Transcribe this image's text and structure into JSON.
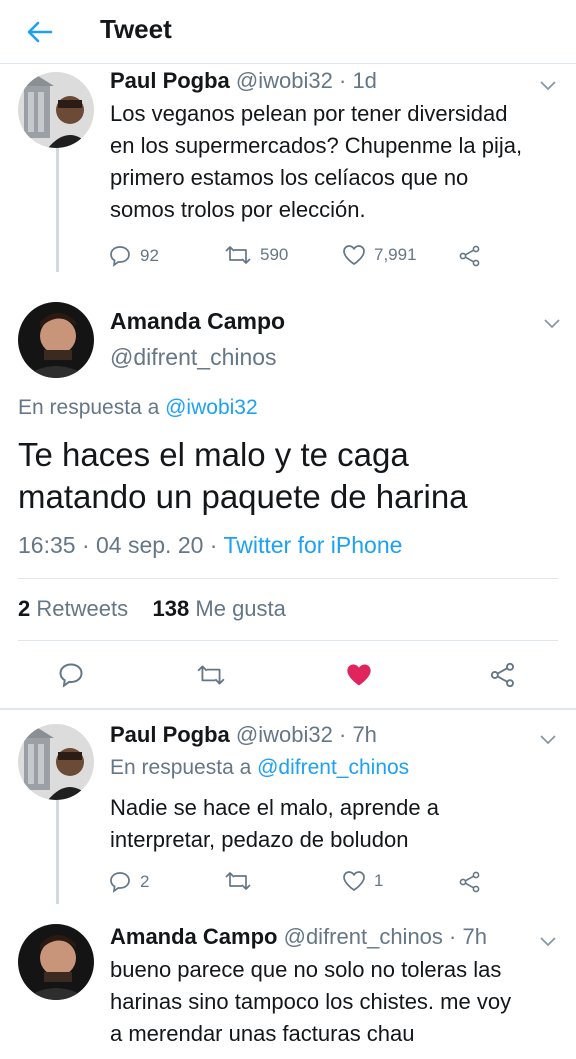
{
  "header": {
    "title": "Tweet"
  },
  "tweets": [
    {
      "name": "Paul Pogba",
      "handle": "@iwobi32",
      "separator": "·",
      "time": "1d",
      "lines": [
        "Los veganos pelean por tener diversidad",
        "en los supermercados? Chupenme la pija,",
        "primero estamos los celíacos que no",
        "somos trolos por elección."
      ],
      "replies": "92",
      "retweets": "590",
      "likes": "7,991"
    },
    {
      "name": "Paul Pogba",
      "handle": "@iwobi32",
      "separator": "·",
      "time": "7h",
      "replying_prefix": "En respuesta a",
      "replying_to": "@difrent_chinos",
      "lines": [
        "Nadie se hace el malo, aprende a",
        "interpretar, pedazo de boludon"
      ],
      "replies": "2",
      "retweets": "",
      "likes": "1"
    },
    {
      "name": "Amanda Campo",
      "handle": "@difrent_chinos",
      "separator": "·",
      "time": "7h",
      "lines": [
        "bueno parece que no solo no toleras las",
        "harinas sino tampoco los chistes. me voy",
        "a merendar unas facturas chau"
      ]
    }
  ],
  "main_tweet": {
    "name": "Amanda Campo",
    "handle": "@difrent_chinos",
    "replying_prefix": "En respuesta a",
    "replying_to": "@iwobi32",
    "lines": [
      "Te haces el malo y te caga",
      "matando un paquete de harina"
    ],
    "time": "16:35 · 04 sep. 20 ·",
    "source": "Twitter for iPhone",
    "retweets_count": "2",
    "retweets_label": "Retweets",
    "likes_count": "138",
    "likes_label": "Me gusta"
  },
  "colors": {
    "accent": "#1da1f2",
    "like_active": "#e0245e",
    "muted": "#657786",
    "text": "#14171a",
    "divider": "#e1e8ed"
  },
  "icons": [
    "back-arrow-icon",
    "reply-icon",
    "retweet-icon",
    "heart-icon",
    "share-icon",
    "chevron-down-icon"
  ]
}
